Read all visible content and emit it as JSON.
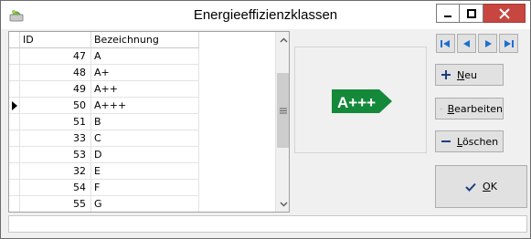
{
  "window": {
    "title": "Energieeffizienzklassen",
    "close_color": "#c7463f"
  },
  "grid": {
    "columns": [
      "ID",
      "Bezeichnung"
    ],
    "rows": [
      {
        "id": "47",
        "name": "A",
        "current": false
      },
      {
        "id": "48",
        "name": "A+",
        "current": false
      },
      {
        "id": "49",
        "name": "A++",
        "current": false
      },
      {
        "id": "50",
        "name": "A+++",
        "current": true
      },
      {
        "id": "51",
        "name": "B",
        "current": false
      },
      {
        "id": "33",
        "name": "C",
        "current": false
      },
      {
        "id": "53",
        "name": "D",
        "current": false
      },
      {
        "id": "32",
        "name": "E",
        "current": false
      },
      {
        "id": "54",
        "name": "F",
        "current": false
      },
      {
        "id": "55",
        "name": "G",
        "current": false
      }
    ]
  },
  "image": {
    "label": "A+++",
    "color": "#14893a"
  },
  "navigation": {
    "icons": [
      "first-record-icon",
      "previous-record-icon",
      "next-record-icon",
      "last-record-icon"
    ],
    "color": "#1e6fd0"
  },
  "buttons": {
    "new": {
      "accel": "N",
      "rest": "eu"
    },
    "edit": {
      "accel": "B",
      "rest": "earbeiten"
    },
    "delete": {
      "accel": "L",
      "rest": "öschen"
    },
    "ok": {
      "accel": "O",
      "rest": "K"
    }
  },
  "status": ""
}
